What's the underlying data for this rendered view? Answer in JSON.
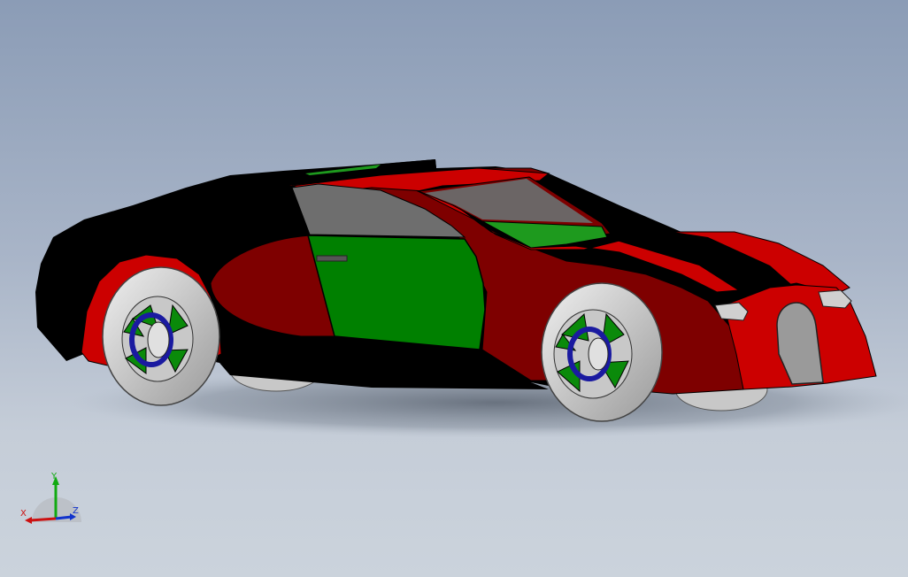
{
  "viewport": {
    "background_top": "#8b9cb6",
    "background_bottom": "#cbd3dc"
  },
  "model": {
    "colors": {
      "body_red": "#cc0000",
      "dark_red": "#7e0000",
      "black": "#000000",
      "door_green": "#008000",
      "glass_gray": "#6e6e6e",
      "tire_gray": "#d6d6d6",
      "hub_blue": "#1a1aa0"
    }
  },
  "triad": {
    "x_label": "X",
    "y_label": "Y",
    "z_label": "Z",
    "x_color": "#cc1111",
    "y_color": "#11aa11",
    "z_color": "#1133cc"
  }
}
